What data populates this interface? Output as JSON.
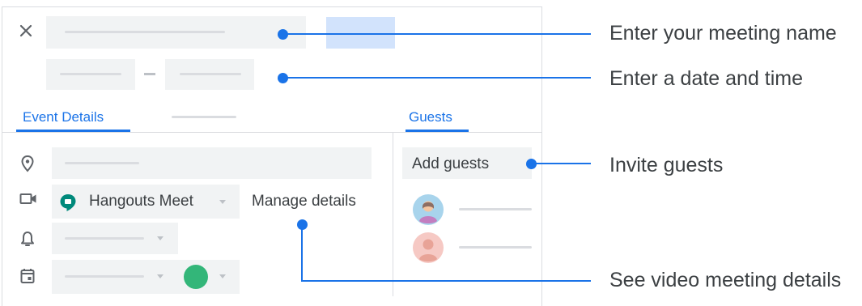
{
  "dialog": {
    "tabs": {
      "event_details": "Event Details",
      "guests": "Guests"
    },
    "conference": {
      "name": "Hangouts Meet",
      "manage_link": "Manage details"
    },
    "guests": {
      "add_placeholder": "Add guests"
    },
    "icons": [
      "close-icon",
      "location-icon",
      "video-camera-icon",
      "bell-icon",
      "calendar-icon",
      "hangouts-meet-icon"
    ],
    "colors": {
      "accent": "#1a73e8",
      "selected_slot": "#d2e3fc",
      "event_color": "#33b679",
      "meet_green": "#00897b"
    }
  },
  "callouts": {
    "meeting_name": "Enter your meeting name",
    "date_time": "Enter a date and time",
    "guests": "Invite guests",
    "video_details": "See video meeting details"
  }
}
